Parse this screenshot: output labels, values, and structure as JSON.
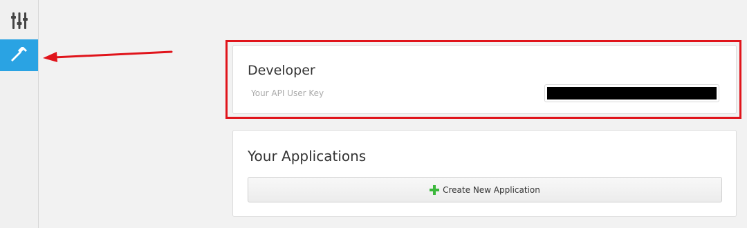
{
  "sidebar": {
    "items": [
      {
        "name": "settings",
        "icon": "sliders-icon",
        "active": false
      },
      {
        "name": "developer",
        "icon": "hammer-icon",
        "active": true
      }
    ],
    "active_color": "#2aa3e3"
  },
  "developer": {
    "title": "Developer",
    "api_key_label": "Your API User Key",
    "api_key_value": ""
  },
  "applications": {
    "title": "Your Applications",
    "create_button_label": "Create New Application",
    "create_icon": "plus-icon"
  },
  "annotation": {
    "highlight_color": "#e0141b",
    "arrow_icon": "arrow-left-icon"
  }
}
